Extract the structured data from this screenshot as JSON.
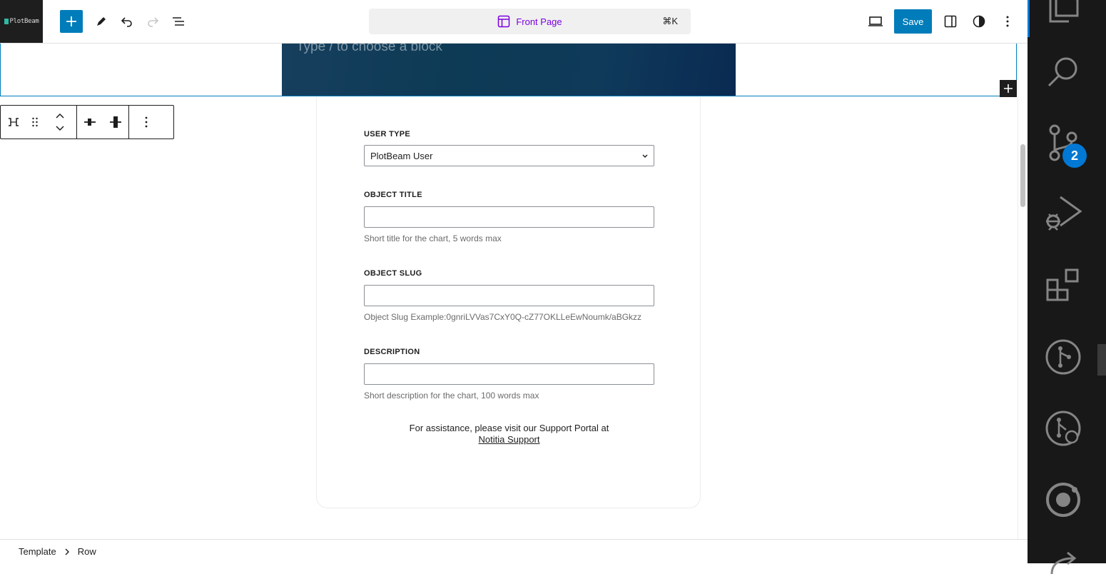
{
  "header": {
    "site_logo_text": "PlotBeam",
    "document_title": "Front Page",
    "command_shortcut": "⌘K",
    "save_label": "Save"
  },
  "canvas": {
    "cover_placeholder": "Type / to choose a block"
  },
  "form": {
    "user_type": {
      "label": "USER TYPE",
      "value": "PlotBeam User"
    },
    "object_title": {
      "label": "OBJECT TITLE",
      "value": "",
      "help": "Short title for the chart, 5 words max"
    },
    "object_slug": {
      "label": "OBJECT SLUG",
      "value": "",
      "help": "Object Slug Example:0gnriLVVas7CxY0Q-cZ77OKLLeEwNoumk/aBGkzz"
    },
    "description": {
      "label": "DESCRIPTION",
      "value": "",
      "help": "Short description for the chart, 100 words max"
    },
    "assist_text": "For assistance, please visit our Support Portal at",
    "assist_link": "Notitia Support"
  },
  "breadcrumb": {
    "items": [
      "Template",
      "Row"
    ]
  },
  "activity_bar": {
    "source_control_badge": "2"
  },
  "colors": {
    "accent": "#007cba",
    "command_title": "#7a00df",
    "vscode_badge": "#0078d4",
    "activity_bg": "#181818"
  }
}
